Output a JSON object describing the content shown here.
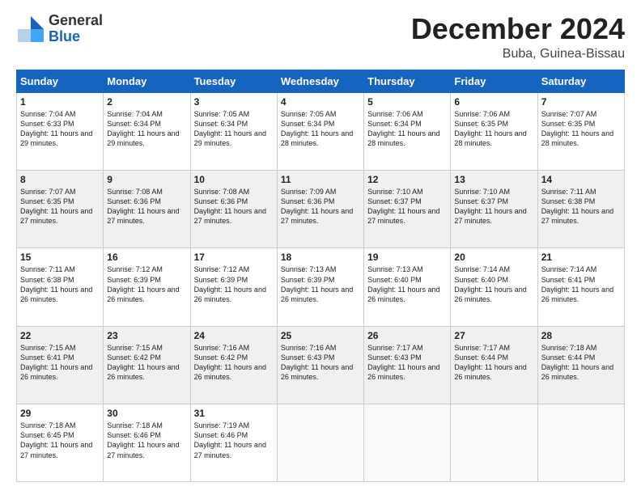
{
  "logo": {
    "general": "General",
    "blue": "Blue"
  },
  "title": {
    "month_year": "December 2024",
    "location": "Buba, Guinea-Bissau"
  },
  "weekdays": [
    "Sunday",
    "Monday",
    "Tuesday",
    "Wednesday",
    "Thursday",
    "Friday",
    "Saturday"
  ],
  "weeks": [
    [
      {
        "day": "1",
        "sunrise": "Sunrise: 7:04 AM",
        "sunset": "Sunset: 6:33 PM",
        "daylight": "Daylight: 11 hours and 29 minutes."
      },
      {
        "day": "2",
        "sunrise": "Sunrise: 7:04 AM",
        "sunset": "Sunset: 6:34 PM",
        "daylight": "Daylight: 11 hours and 29 minutes."
      },
      {
        "day": "3",
        "sunrise": "Sunrise: 7:05 AM",
        "sunset": "Sunset: 6:34 PM",
        "daylight": "Daylight: 11 hours and 29 minutes."
      },
      {
        "day": "4",
        "sunrise": "Sunrise: 7:05 AM",
        "sunset": "Sunset: 6:34 PM",
        "daylight": "Daylight: 11 hours and 28 minutes."
      },
      {
        "day": "5",
        "sunrise": "Sunrise: 7:06 AM",
        "sunset": "Sunset: 6:34 PM",
        "daylight": "Daylight: 11 hours and 28 minutes."
      },
      {
        "day": "6",
        "sunrise": "Sunrise: 7:06 AM",
        "sunset": "Sunset: 6:35 PM",
        "daylight": "Daylight: 11 hours and 28 minutes."
      },
      {
        "day": "7",
        "sunrise": "Sunrise: 7:07 AM",
        "sunset": "Sunset: 6:35 PM",
        "daylight": "Daylight: 11 hours and 28 minutes."
      }
    ],
    [
      {
        "day": "8",
        "sunrise": "Sunrise: 7:07 AM",
        "sunset": "Sunset: 6:35 PM",
        "daylight": "Daylight: 11 hours and 27 minutes."
      },
      {
        "day": "9",
        "sunrise": "Sunrise: 7:08 AM",
        "sunset": "Sunset: 6:36 PM",
        "daylight": "Daylight: 11 hours and 27 minutes."
      },
      {
        "day": "10",
        "sunrise": "Sunrise: 7:08 AM",
        "sunset": "Sunset: 6:36 PM",
        "daylight": "Daylight: 11 hours and 27 minutes."
      },
      {
        "day": "11",
        "sunrise": "Sunrise: 7:09 AM",
        "sunset": "Sunset: 6:36 PM",
        "daylight": "Daylight: 11 hours and 27 minutes."
      },
      {
        "day": "12",
        "sunrise": "Sunrise: 7:10 AM",
        "sunset": "Sunset: 6:37 PM",
        "daylight": "Daylight: 11 hours and 27 minutes."
      },
      {
        "day": "13",
        "sunrise": "Sunrise: 7:10 AM",
        "sunset": "Sunset: 6:37 PM",
        "daylight": "Daylight: 11 hours and 27 minutes."
      },
      {
        "day": "14",
        "sunrise": "Sunrise: 7:11 AM",
        "sunset": "Sunset: 6:38 PM",
        "daylight": "Daylight: 11 hours and 27 minutes."
      }
    ],
    [
      {
        "day": "15",
        "sunrise": "Sunrise: 7:11 AM",
        "sunset": "Sunset: 6:38 PM",
        "daylight": "Daylight: 11 hours and 26 minutes."
      },
      {
        "day": "16",
        "sunrise": "Sunrise: 7:12 AM",
        "sunset": "Sunset: 6:39 PM",
        "daylight": "Daylight: 11 hours and 26 minutes."
      },
      {
        "day": "17",
        "sunrise": "Sunrise: 7:12 AM",
        "sunset": "Sunset: 6:39 PM",
        "daylight": "Daylight: 11 hours and 26 minutes."
      },
      {
        "day": "18",
        "sunrise": "Sunrise: 7:13 AM",
        "sunset": "Sunset: 6:39 PM",
        "daylight": "Daylight: 11 hours and 26 minutes."
      },
      {
        "day": "19",
        "sunrise": "Sunrise: 7:13 AM",
        "sunset": "Sunset: 6:40 PM",
        "daylight": "Daylight: 11 hours and 26 minutes."
      },
      {
        "day": "20",
        "sunrise": "Sunrise: 7:14 AM",
        "sunset": "Sunset: 6:40 PM",
        "daylight": "Daylight: 11 hours and 26 minutes."
      },
      {
        "day": "21",
        "sunrise": "Sunrise: 7:14 AM",
        "sunset": "Sunset: 6:41 PM",
        "daylight": "Daylight: 11 hours and 26 minutes."
      }
    ],
    [
      {
        "day": "22",
        "sunrise": "Sunrise: 7:15 AM",
        "sunset": "Sunset: 6:41 PM",
        "daylight": "Daylight: 11 hours and 26 minutes."
      },
      {
        "day": "23",
        "sunrise": "Sunrise: 7:15 AM",
        "sunset": "Sunset: 6:42 PM",
        "daylight": "Daylight: 11 hours and 26 minutes."
      },
      {
        "day": "24",
        "sunrise": "Sunrise: 7:16 AM",
        "sunset": "Sunset: 6:42 PM",
        "daylight": "Daylight: 11 hours and 26 minutes."
      },
      {
        "day": "25",
        "sunrise": "Sunrise: 7:16 AM",
        "sunset": "Sunset: 6:43 PM",
        "daylight": "Daylight: 11 hours and 26 minutes."
      },
      {
        "day": "26",
        "sunrise": "Sunrise: 7:17 AM",
        "sunset": "Sunset: 6:43 PM",
        "daylight": "Daylight: 11 hours and 26 minutes."
      },
      {
        "day": "27",
        "sunrise": "Sunrise: 7:17 AM",
        "sunset": "Sunset: 6:44 PM",
        "daylight": "Daylight: 11 hours and 26 minutes."
      },
      {
        "day": "28",
        "sunrise": "Sunrise: 7:18 AM",
        "sunset": "Sunset: 6:44 PM",
        "daylight": "Daylight: 11 hours and 26 minutes."
      }
    ],
    [
      {
        "day": "29",
        "sunrise": "Sunrise: 7:18 AM",
        "sunset": "Sunset: 6:45 PM",
        "daylight": "Daylight: 11 hours and 27 minutes."
      },
      {
        "day": "30",
        "sunrise": "Sunrise: 7:18 AM",
        "sunset": "Sunset: 6:46 PM",
        "daylight": "Daylight: 11 hours and 27 minutes."
      },
      {
        "day": "31",
        "sunrise": "Sunrise: 7:19 AM",
        "sunset": "Sunset: 6:46 PM",
        "daylight": "Daylight: 11 hours and 27 minutes."
      },
      null,
      null,
      null,
      null
    ]
  ]
}
